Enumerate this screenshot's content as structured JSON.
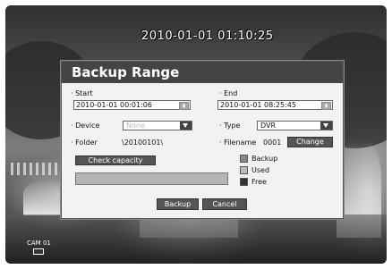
{
  "osd": {
    "datetime": "2010-01-01 01:10:25",
    "camera": "CAM 01"
  },
  "dialog": {
    "title": "Backup Range",
    "start_label": "· Start",
    "start_value": "2010-01-01 00:01:06",
    "end_label": "· End",
    "end_value": "2010-01-01 08:25:45",
    "device_label": "· Device",
    "device_value": "None",
    "type_label": "· Type",
    "type_value": "DVR",
    "folder_label": "· Folder",
    "folder_value": "\\20100101\\",
    "filename_label": "· Filename",
    "filename_value": "0001",
    "change_button": "Change",
    "check_capacity_button": "Check capacity",
    "legend": {
      "backup": "Backup",
      "used": "Used",
      "free": "Free"
    },
    "backup_button": "Backup",
    "cancel_button": "Cancel"
  },
  "colors": {
    "title_bar": "#444444",
    "legend_backup": "#888888",
    "legend_used": "#bbbbbb",
    "legend_free": "#333333"
  },
  "icons": {
    "spin": "up-down-arrow-icon",
    "dropdown": "chevron-down-icon",
    "camera": "camera-icon"
  }
}
